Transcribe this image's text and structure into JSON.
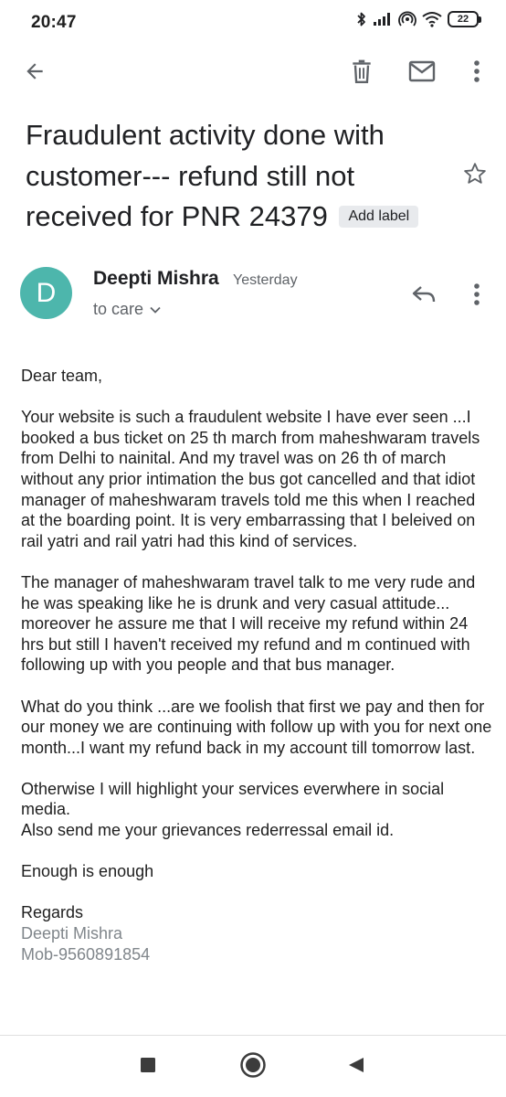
{
  "status_bar": {
    "time": "20:47",
    "battery": "22",
    "icons": [
      "bluetooth-icon",
      "signal-icon",
      "hotspot-icon",
      "wifi-icon",
      "battery-icon"
    ]
  },
  "toolbar": {
    "icons": [
      "back-arrow-icon",
      "delete-icon",
      "mark-unread-icon",
      "more-vert-icon"
    ]
  },
  "email": {
    "subject": "Fraudulent activity done with customer--- refund still not received for PNR 24379",
    "label_chip": "Add label",
    "sender": {
      "initial": "D",
      "name": "Deepti Mishra",
      "time": "Yesterday",
      "recipient": "to care",
      "avatar_color": "#4db6ac"
    },
    "body": {
      "greeting": "Dear team,",
      "paragraph_1": "Your website is such a fraudulent website I have ever seen ...I booked a bus ticket on 25 th march from maheshwaram travels from Delhi to nainital. And my travel was on 26 th of march without any prior intimation the bus got cancelled and that idiot manager of maheshwaram travels told me this when I reached at the boarding point. It is very embarrassing that I beleived on rail yatri and rail yatri had this kind of services.",
      "paragraph_2": "The manager of maheshwaram travel talk to me very rude and he was speaking like he is drunk and very casual attitude... moreover he assure me that I will receive my refund within 24 hrs but still I haven't received my refund and m continued with following up with you people and that bus manager.",
      "paragraph_3": "What do you think ...are we foolish that first we pay and then for our money we are continuing with follow up with you for next one month...I want my refund back in my account till tomorrow last.",
      "paragraph_4_line_1": "Otherwise I will highlight your services everwhere in social media.",
      "paragraph_4_line_2": "Also send me your grievances rederressal email id.",
      "closing_line": "Enough is enough",
      "regards": "Regards",
      "signature_name": "Deepti Mishra",
      "signature_phone": "Mob-9560891854"
    }
  },
  "nav_bar": {
    "icons": [
      "recents-square-icon",
      "home-circle-icon",
      "back-triangle-icon"
    ]
  }
}
